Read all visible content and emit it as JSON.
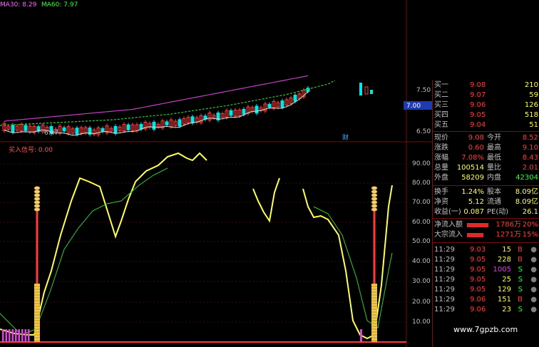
{
  "header": {
    "ma30": "MA30: 8.29",
    "ma60": "MA60: 7.97",
    "indicator": "买入信号: 0.00"
  },
  "price_axis": {
    "ticks": [
      "7.50",
      "7.00",
      "6.50"
    ],
    "current": "7.00",
    "low_marker": "6.47",
    "event_marker": "财"
  },
  "indicator_axis": {
    "ticks": [
      "90.00",
      "80.00",
      "70.00",
      "60.00",
      "50.00",
      "40.00",
      "30.00",
      "20.00",
      "10.00"
    ]
  },
  "order_book": [
    {
      "label": "买一",
      "price": "9.08",
      "vol": "210"
    },
    {
      "label": "买二",
      "price": "9.07",
      "vol": "59"
    },
    {
      "label": "买三",
      "price": "9.06",
      "vol": "126"
    },
    {
      "label": "买四",
      "price": "9.05",
      "vol": "518"
    },
    {
      "label": "买五",
      "price": "9.04",
      "vol": "51"
    }
  ],
  "stats": [
    {
      "l1": "现价",
      "v1": "9.08",
      "l2": "今开",
      "v2": "8.52"
    },
    {
      "l1": "涨跌",
      "v1": "0.60",
      "l2": "最高",
      "v2": "9.10"
    },
    {
      "l1": "涨幅",
      "v1": "7.08%",
      "l2": "最低",
      "v2": "8.43"
    },
    {
      "l1": "总量",
      "v1": "100514",
      "l2": "量比",
      "v2": "2.01"
    },
    {
      "l1": "外盘",
      "v1": "58209",
      "l2": "内盘",
      "v2": "42304"
    }
  ],
  "fundamentals": [
    {
      "l1": "换手",
      "v1": "1.24%",
      "l2": "股本",
      "v2": "8.09亿"
    },
    {
      "l1": "净资",
      "v1": "5.12",
      "l2": "流通",
      "v2": "8.09亿"
    },
    {
      "l1": "收益(一)",
      "v1": "0.087",
      "l2": "PE(动)",
      "v2": "26.1"
    }
  ],
  "flows": [
    {
      "label": "净流入额",
      "amount": "1786万",
      "pct": "20%",
      "bar_fraction": 0.2
    },
    {
      "label": "大宗流入",
      "amount": "1271万",
      "pct": "15%",
      "bar_fraction": 0.15
    }
  ],
  "ticks": [
    {
      "time": "11:29",
      "price": "9.03",
      "vol": "15",
      "side": "B"
    },
    {
      "time": "11:29",
      "price": "9.05",
      "vol": "228",
      "side": "B"
    },
    {
      "time": "11:29",
      "price": "9.05",
      "vol": "1005",
      "side": "S"
    },
    {
      "time": "11:29",
      "price": "9.05",
      "vol": "25",
      "side": "S"
    },
    {
      "time": "11:29",
      "price": "9.05",
      "vol": "129",
      "side": "S"
    },
    {
      "time": "11:29",
      "price": "9.06",
      "vol": "151",
      "side": "B"
    },
    {
      "time": "11:29",
      "price": "9.06",
      "vol": "23",
      "side": "S"
    }
  ],
  "watermark": "www.7gpzb.com",
  "colors": {
    "up": "#ff3b3b",
    "down": "#00e5e5",
    "accent_yellow": "#ffff55",
    "border": "#7a0d0d"
  }
}
